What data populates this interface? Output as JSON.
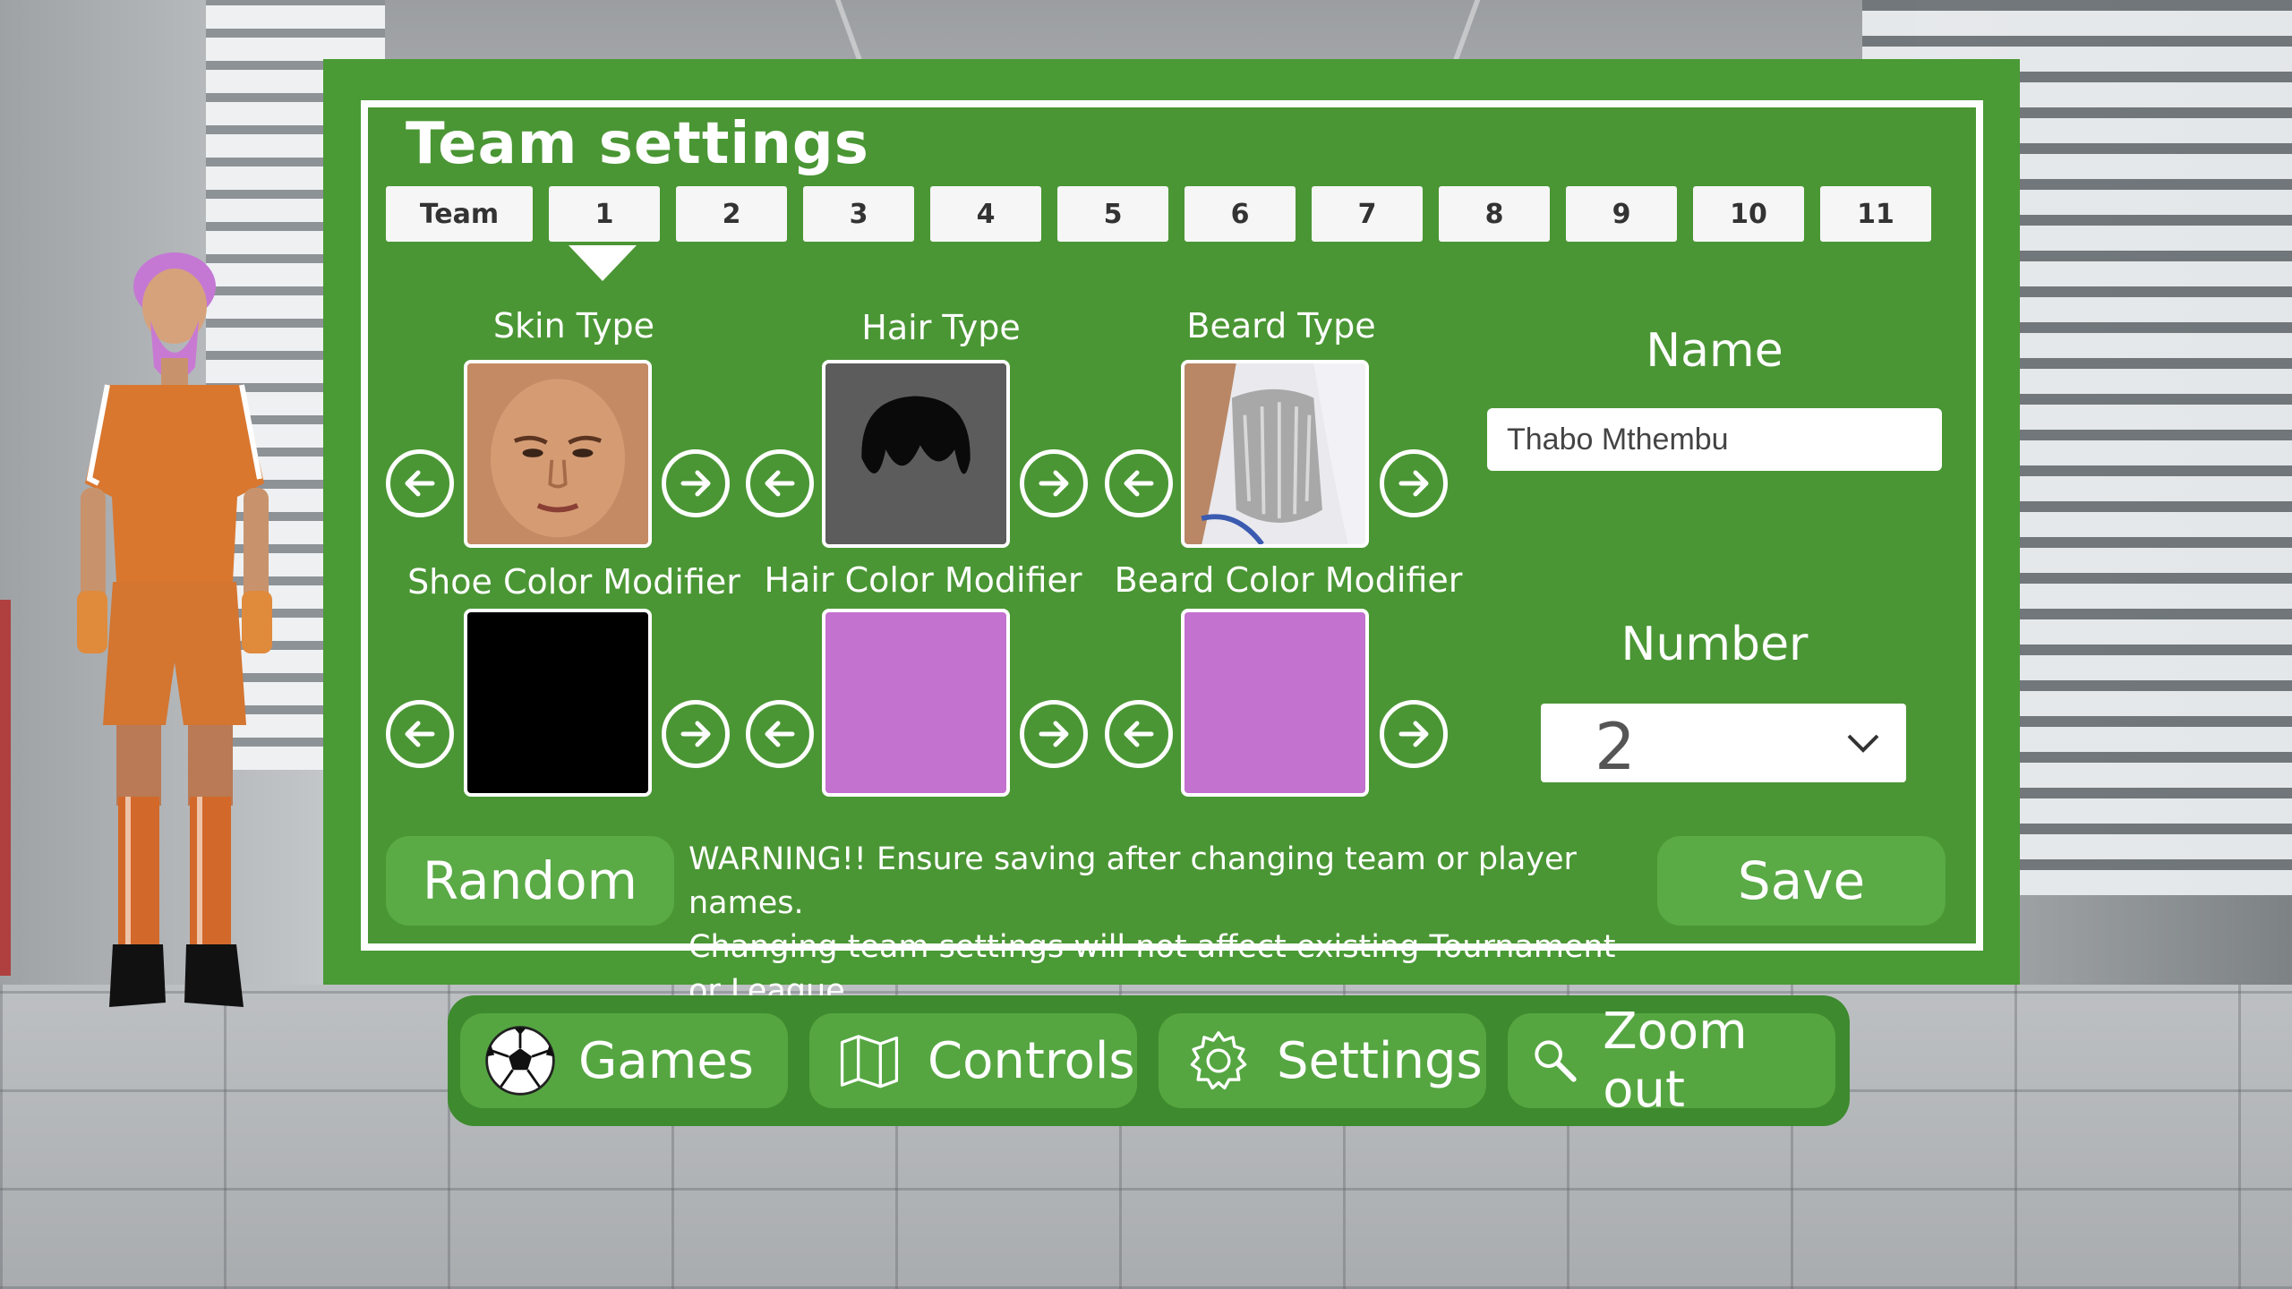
{
  "panel": {
    "title": "Team settings",
    "tabs": [
      "Team",
      "1",
      "2",
      "3",
      "4",
      "5",
      "6",
      "7",
      "8",
      "9",
      "10",
      "11"
    ],
    "selected_tab": "1",
    "options": {
      "skin_type": "Skin Type",
      "hair_type": "Hair Type",
      "beard_type": "Beard Type",
      "shoe_color": "Shoe Color Modifier",
      "hair_color": "Hair Color Modifier",
      "beard_color": "Beard Color Modifier"
    },
    "swatch_colors": {
      "shoe": "#000000",
      "hair": "#c472cf",
      "beard": "#c472cf"
    },
    "name_label": "Name",
    "name_value": "Thabo Mthembu",
    "number_label": "Number",
    "number_value": "2",
    "random_label": "Random",
    "warning_line1": "WARNING!! Ensure saving after changing team or player names.",
    "warning_line2": "Changing team settings will not affect existing Tournament or League",
    "save_label": "Save"
  },
  "nav": {
    "games": "Games",
    "controls": "Controls",
    "settings": "Settings",
    "zoom_out": "Zoom out",
    "icons": [
      "soccer-ball-icon",
      "map-icon",
      "gear-icon",
      "magnifier-icon"
    ]
  },
  "colors": {
    "panel_green": "#4a9a36",
    "button_green": "#5aaa46",
    "jersey_orange": "#d9772f"
  }
}
